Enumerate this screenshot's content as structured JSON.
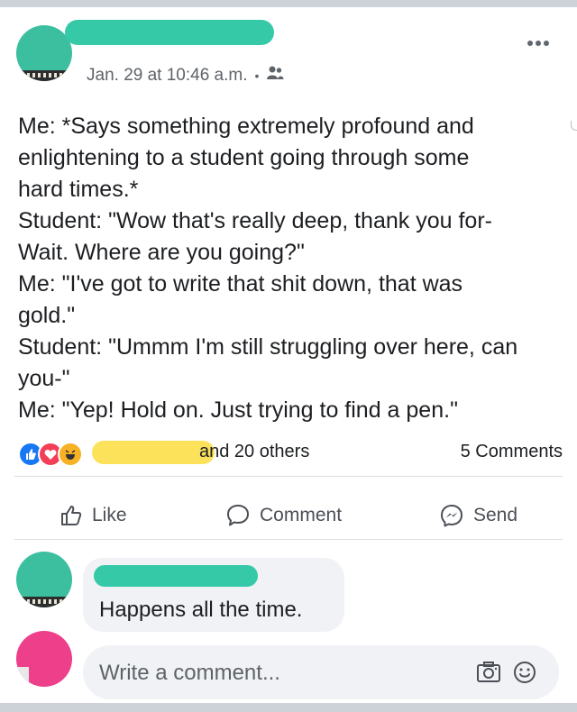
{
  "post": {
    "timestamp": "Jan. 29 at 10:46 a.m.",
    "separator": "•",
    "audience_icon": "friends-icon",
    "more_icon": "more-options-icon",
    "lines": [
      "Me: *Says something extremely profound and",
      "enlightening to a student going through some",
      "hard times.*",
      "Student: \"Wow that's really deep, thank you for-",
      "Wait. Where are you going?\"",
      "Me: \"I've got to write that shit down, that was",
      "gold.\"",
      "Student: \"Ummm I'm still struggling over here, can",
      "you-\"",
      "Me: \"Yep! Hold on. Just trying to find a pen.\""
    ]
  },
  "reactions": {
    "icons": [
      "like-reaction-icon",
      "love-reaction-icon",
      "haha-reaction-icon"
    ],
    "others_text": "and 20 others",
    "comments_count": "5 Comments"
  },
  "actions": {
    "like_label": "Like",
    "comment_label": "Comment",
    "send_label": "Send"
  },
  "comments": [
    {
      "text": "Happens all the time."
    }
  ],
  "composer": {
    "placeholder": "Write a comment..."
  },
  "colors": {
    "redaction_teal": "#35c9a8",
    "redaction_yellow": "#fbe25a",
    "avatar_pink": "#ee3f8a",
    "like_blue": "#1877f2"
  }
}
